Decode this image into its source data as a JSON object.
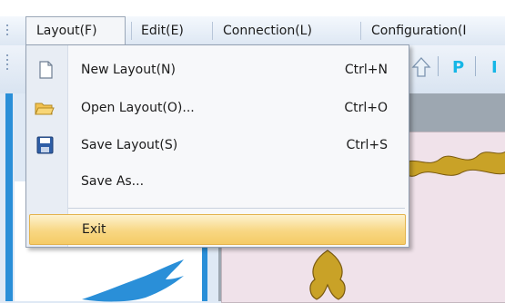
{
  "menubar": {
    "items": [
      {
        "label": "Layout(F)"
      },
      {
        "label": "Edit(E)"
      },
      {
        "label": "Connection(L)"
      },
      {
        "label": "Configuration(I"
      }
    ]
  },
  "toolbar": {
    "p_label": "P",
    "i_label": "I"
  },
  "layout_menu": {
    "items": [
      {
        "label": "New Layout(N)",
        "shortcut": "Ctrl+N",
        "icon": "new-file-icon"
      },
      {
        "label": "Open Layout(O)...",
        "shortcut": "Ctrl+O",
        "icon": "open-folder-icon"
      },
      {
        "label": "Save Layout(S)",
        "shortcut": "Ctrl+S",
        "icon": "floppy-disk-icon"
      },
      {
        "label": "Save As...",
        "shortcut": "",
        "icon": ""
      },
      {
        "label": "Exit",
        "shortcut": "",
        "icon": ""
      }
    ],
    "highlighted": "Exit"
  },
  "colors": {
    "highlight": "#f8d783",
    "toolbar_accent": "#16b6e6",
    "panel_border": "#2a8fd8"
  }
}
